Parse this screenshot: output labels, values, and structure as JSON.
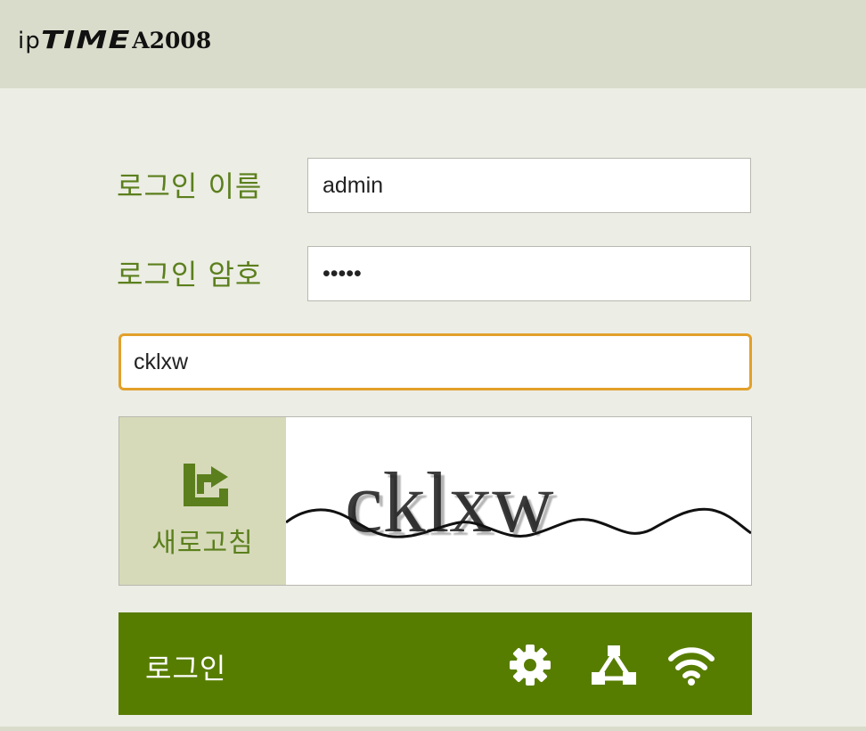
{
  "header": {
    "brand_prefix": "ip",
    "brand_name": "TIME",
    "model": "A2008"
  },
  "form": {
    "username_label": "로그인 이름",
    "username_value": "admin",
    "password_label": "로그인 암호",
    "password_value": "admin",
    "captcha_input_value": "cklxw"
  },
  "captcha": {
    "refresh_label": "새로고침",
    "image_text": "cklxw"
  },
  "login_bar": {
    "login_label": "로그인",
    "icons": [
      "gear-icon",
      "network-icon",
      "wifi-icon"
    ]
  },
  "colors": {
    "accent_green": "#577d00",
    "label_green": "#5b7f1d",
    "focus_border": "#e2a02a",
    "header_bg": "#d9dccb",
    "page_bg": "#ecede4"
  }
}
